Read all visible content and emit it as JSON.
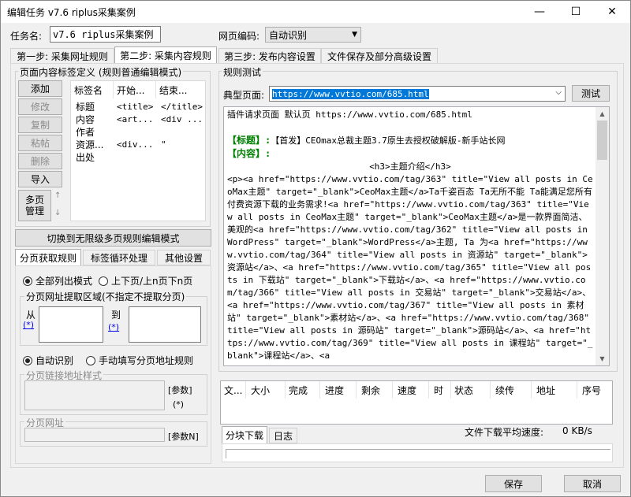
{
  "window": {
    "title": "编辑任务 v7.6 riplus采集案例",
    "minimize": "—",
    "maximize": "☐",
    "close": "✕"
  },
  "task": {
    "name_label": "任务名:",
    "name_value": "v7.6 riplus采集案例",
    "encoding_label": "网页编码:",
    "encoding_value": "自动识别"
  },
  "steps": [
    "第一步: 采集网址规则",
    "第二步: 采集内容规则",
    "第三步: 发布内容设置",
    "文件保存及部分高级设置"
  ],
  "left": {
    "group_title": "页面内容标签定义 (规则普通编辑模式)",
    "buttons": [
      "添加",
      "修改",
      "复制",
      "粘帖",
      "删除",
      "导入"
    ],
    "multipage": "多页\n管理",
    "table": {
      "headers": [
        "标签名",
        "开始...",
        "结束..."
      ],
      "rows": [
        [
          "标题",
          "<title>",
          "</title>"
        ],
        [
          "内容",
          "<art...",
          "<div ..."
        ],
        [
          "作者",
          "",
          ""
        ],
        [
          "资源...",
          "<div...",
          "\""
        ],
        [
          "出处",
          "",
          ""
        ]
      ]
    },
    "switch_button": "切换到无限级多页规则编辑模式",
    "subtabs": [
      "分页获取规则",
      "标签循环处理",
      "其他设置"
    ],
    "radio1": [
      "全部列出模式",
      "上下页/上n页下n页"
    ],
    "region_title": "分页网址提取区域(不指定不提取分页)",
    "from": "从",
    "to": "到",
    "star": "(*)",
    "radio2": [
      "自动识别",
      "手动填写分页地址规则"
    ],
    "link_style_title": "分页链接地址样式",
    "param": "[参数]",
    "param_star": "(*)",
    "page_url_title": "分页网址",
    "param2": "[参数N]"
  },
  "right": {
    "group_title": "规则测试",
    "typical_label": "典型页面:",
    "typical_url": "https://www.vvtio.com/685.html",
    "test_button": "测试",
    "result_header": "插件请求页面 默认页 https://www.vvtio.com/685.html",
    "title_label": "【标题】:",
    "title_value": "【首发】CEOmax总裁主题3.7原生去授权破解版-新手站长网",
    "content_label": "【内容】:",
    "content_h3": "<h3>主题介绍</h3>",
    "content_body": "<p><a href=\"https://www.vvtio.com/tag/363\" title=\"View all posts in CeoMax主题\" target=\"_blank\">CeoMax主题</a>Ta千姿百态 Ta无所不能 Ta能满足您所有付费资源下载的业务需求!<a href=\"https://www.vvtio.com/tag/363\" title=\"View all posts in CeoMax主题\" target=\"_blank\">CeoMax主题</a>是一款界面简洁、美观的<a href=\"https://www.vvtio.com/tag/362\" title=\"View all posts in WordPress\" target=\"_blank\">WordPress</a>主题, Ta 为<a href=\"https://www.vvtio.com/tag/364\" title=\"View all posts in 资源站\" target=\"_blank\">资源站</a>、<a href=\"https://www.vvtio.com/tag/365\" title=\"View all posts in 下载站\" target=\"_blank\">下载站</a>、<a href=\"https://www.vvtio.com/tag/366\" title=\"View all posts in 交易站\" target=\"_blank\">交易站</a>、<a href=\"https://www.vvtio.com/tag/367\" title=\"View all posts in 素材站\" target=\"_blank\">素材站</a>、<a href=\"https://www.vvtio.com/tag/368\" title=\"View all posts in 源码站\" target=\"_blank\">源码站</a>、<a href=\"https://www.vvtio.com/tag/369\" title=\"View all posts in 课程站\" target=\"_blank\">课程站</a>、<a",
    "dl_headers": [
      "文...",
      "大小",
      "完成",
      "进度",
      "剩余",
      "速度",
      "时",
      "状态",
      "续传",
      "地址",
      "序号"
    ],
    "bottom_tabs": [
      "分块下载",
      "日志"
    ],
    "speed_label": "文件下载平均速度:",
    "speed_value": "0 KB/s"
  },
  "footer": {
    "save": "保存",
    "cancel": "取消"
  }
}
